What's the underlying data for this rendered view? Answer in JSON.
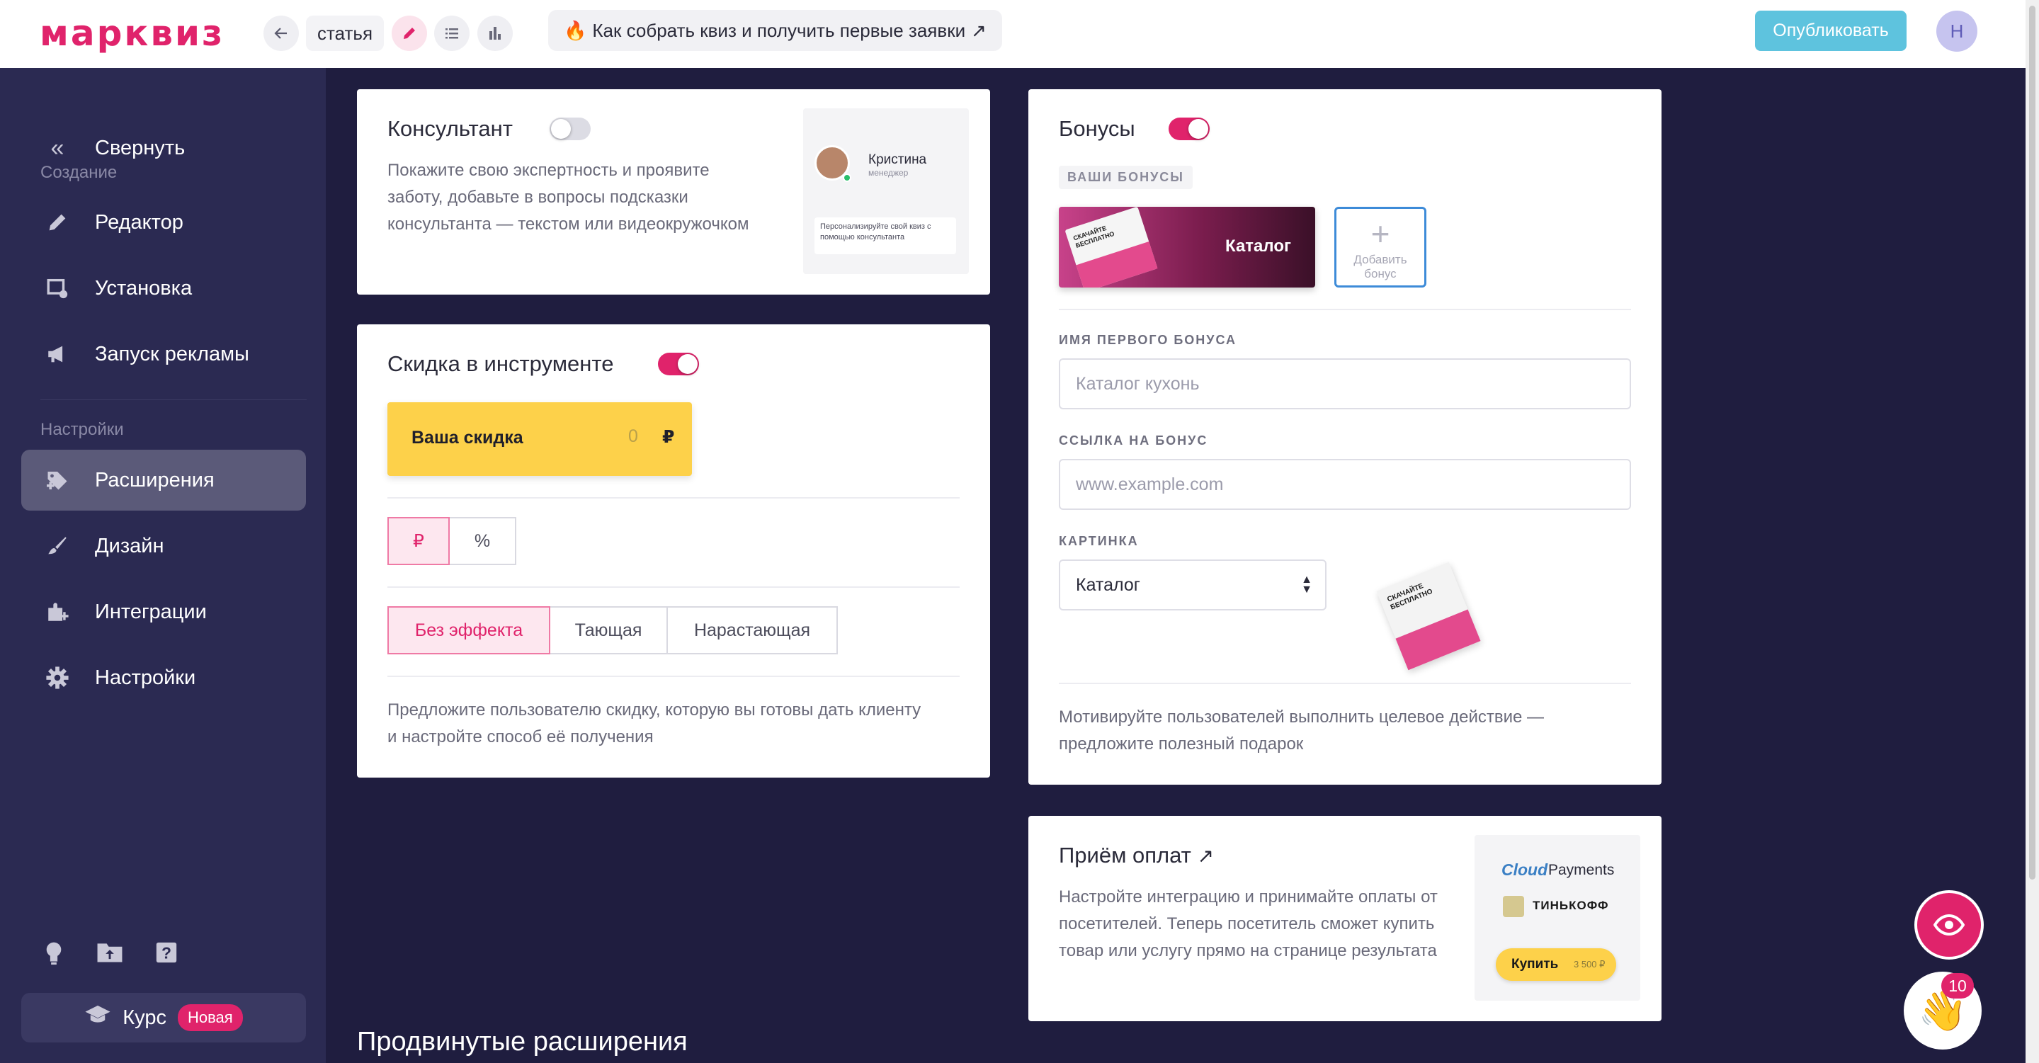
{
  "topbar": {
    "logo": "марквиз",
    "back_icon": "arrow-left-icon",
    "quiz_name": "статья",
    "guide_emoji": "🔥",
    "guide_label": "Как собрать квиз и получить первые заявки",
    "guide_arrow": "↗",
    "publish_label": "Опубликовать",
    "avatar_letter": "Н"
  },
  "sidebar": {
    "collapse_label": "Свернуть",
    "section_create": "Создание",
    "items_create": [
      {
        "label": "Редактор",
        "icon": "pencil-icon"
      },
      {
        "label": "Установка",
        "icon": "install-icon"
      },
      {
        "label": "Запуск рекламы",
        "icon": "megaphone-icon"
      }
    ],
    "section_settings": "Настройки",
    "items_settings": [
      {
        "label": "Расширения",
        "icon": "extension-icon",
        "active": true
      },
      {
        "label": "Дизайн",
        "icon": "brush-icon"
      },
      {
        "label": "Интеграции",
        "icon": "integrations-icon"
      },
      {
        "label": "Настройки",
        "icon": "gear-icon"
      }
    ],
    "course_label": "Курс",
    "course_badge": "Новая"
  },
  "consultant": {
    "title": "Консультант",
    "enabled": false,
    "description": "Покажите свою экспертность и проявите заботу, добавьте в вопросы подсказки консультанта — текстом или видеокружочком",
    "preview_name": "Кристина",
    "preview_role": "менеджер",
    "preview_text": "Персонализируйте свой квиз с помощью консультанта"
  },
  "discount": {
    "title": "Скидка в инструменте",
    "enabled": true,
    "badge_label": "Ваша скидка",
    "badge_value": "0",
    "badge_currency": "₽",
    "units": [
      "₽",
      "%"
    ],
    "selected_unit": "₽",
    "effects": [
      "Без эффекта",
      "Тающая",
      "Нарастающая"
    ],
    "selected_effect": "Без эффекта",
    "description": "Предложите пользователю скидку, которую вы готовы дать клиенту и настройте способ её получения"
  },
  "bonuses": {
    "title": "Бонусы",
    "enabled": true,
    "your_bonuses_label": "ВАШИ БОНУСЫ",
    "bonus_card_label": "Каталог",
    "bonus_thumb_text": "СКАЧАЙТЕ БЕСПЛАТНО",
    "add_bonus_label": "Добавить бонус",
    "name_label": "ИМЯ ПЕРВОГО БОНУСА",
    "name_placeholder": "Каталог кухонь",
    "link_label": "ССЫЛКА НА БОНУС",
    "link_placeholder": "www.example.com",
    "image_label": "КАРТИНКА",
    "image_select_value": "Каталог",
    "description": "Мотивируйте пользователей выполнить целевое действие — предложите полезный подарок"
  },
  "payments": {
    "title": "Приём оплат",
    "title_arrow": "↗",
    "description": "Настройте интеграцию и принимайте оплаты от посетителей. Теперь посетитель сможет купить товар или услугу прямо на странице результата",
    "logo_cloud": "Cloud",
    "logo_payments": "Payments",
    "logo_tinkoff": "ТИНЬКОФФ",
    "buy_label": "Купить",
    "buy_price": "3 500 ₽"
  },
  "advanced_title": "Продвинутые расширения",
  "fab": {
    "preview_icon": "eye-icon",
    "help_icon": "waving-hand-icon",
    "notification_count": "10"
  },
  "colors": {
    "accent": "#e0236b",
    "sidebar_bg": "#2b2a52",
    "page_bg": "#1f1d3f",
    "publish": "#5ec3de",
    "discount_badge": "#fdd14a"
  }
}
